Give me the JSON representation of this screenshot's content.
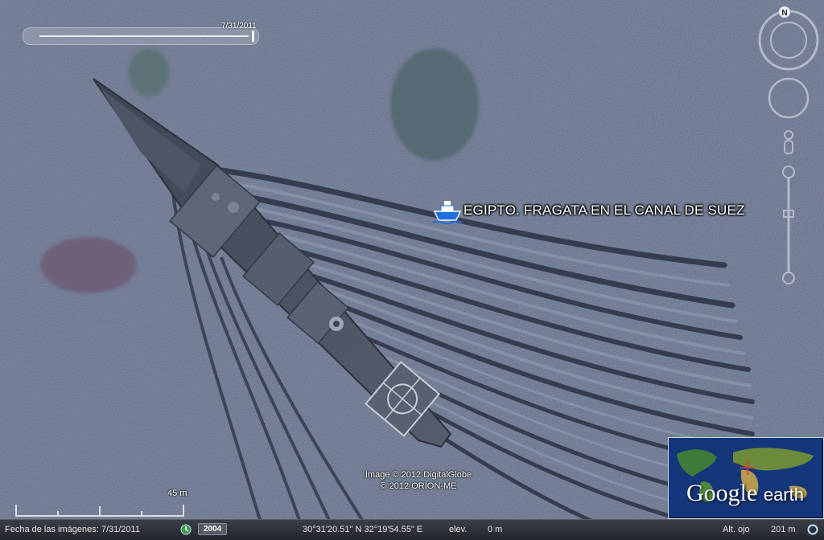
{
  "window": {
    "title": "Google Earth"
  },
  "time_slider": {
    "date": "7/31/2011"
  },
  "placemark": {
    "icon": "ship-icon",
    "label": "EGIPTO. FRAGATA  EN EL CANAL DE SUEZ",
    "icon_color": "#1e6fe0"
  },
  "navigation": {
    "north_label": "N",
    "icons": [
      "compass-ring-icon",
      "look-joystick-icon",
      "street-view-pegman-icon",
      "zoom-slider-icon"
    ]
  },
  "attribution": {
    "line1": "Image © 2012 DigitalGlobe",
    "line2": "© 2012 ORION-ME"
  },
  "scale_bar": {
    "label": "45 m"
  },
  "logo": {
    "word1": "Google",
    "word2": "earth"
  },
  "status_bar": {
    "imagery_date": "Fecha de las imágenes: 7/31/2011",
    "year": "2004",
    "coordinates": "30°31'20.51\" N  32°19'54.55\" E",
    "elev_label": "elev.",
    "elev_value": "0 m",
    "eye_alt_label": "Alt. ojo",
    "eye_alt_value": "201 m"
  },
  "colors": {
    "water": "#5b6680",
    "ship_hull": "#4a5262",
    "wake": "#2a3140",
    "status_bar": "#2c3035"
  }
}
